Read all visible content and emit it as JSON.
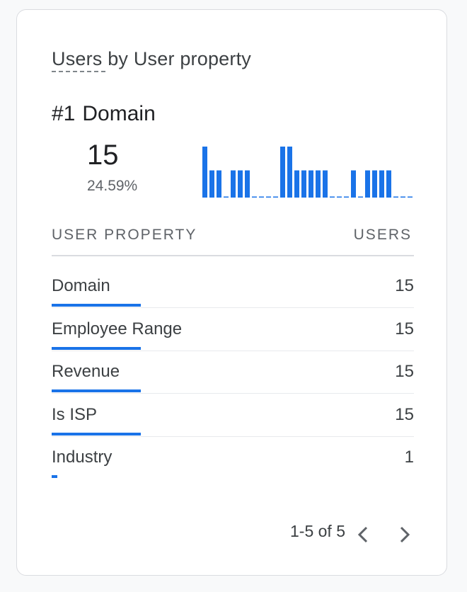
{
  "card": {
    "title": "Users by User property",
    "top_rank": "#1",
    "top_name": "Domain",
    "top_value": "15",
    "top_percent": "24.59%"
  },
  "sparkline": {
    "color": "#1a73e8",
    "max": 15,
    "values": [
      15,
      8,
      8,
      0,
      8,
      8,
      8,
      0,
      0,
      0,
      0,
      15,
      15,
      8,
      8,
      8,
      8,
      8,
      0,
      0,
      0,
      8,
      0,
      8,
      8,
      8,
      8,
      0,
      0,
      0
    ]
  },
  "table": {
    "col_property": "USER PROPERTY",
    "col_users": "USERS",
    "max_value": 15,
    "rows": [
      {
        "label": "Domain",
        "value": "15",
        "fraction": 1.0
      },
      {
        "label": "Employee Range",
        "value": "15",
        "fraction": 1.0
      },
      {
        "label": "Revenue",
        "value": "15",
        "fraction": 1.0
      },
      {
        "label": "Is ISP",
        "value": "15",
        "fraction": 1.0
      },
      {
        "label": "Industry",
        "value": "1",
        "fraction": 0.0667
      }
    ]
  },
  "pagination": {
    "text": "1-5 of 5",
    "prev_icon": "chevron-left-icon",
    "next_icon": "chevron-right-icon"
  }
}
